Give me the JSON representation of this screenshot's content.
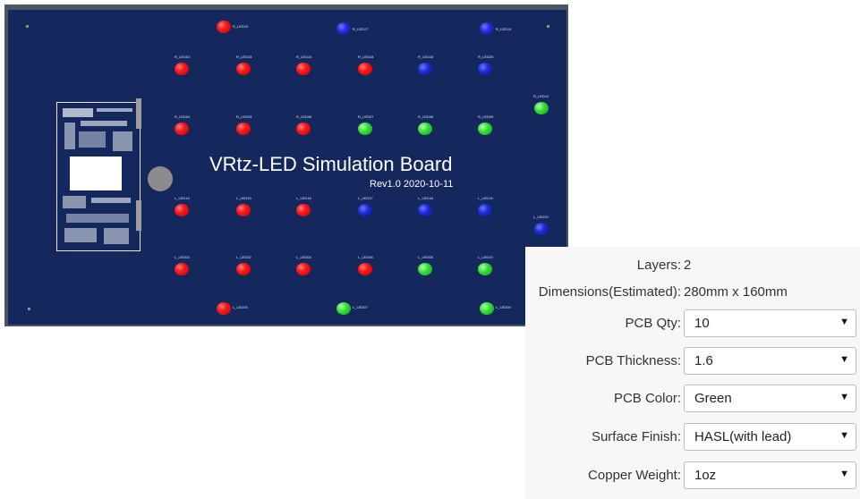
{
  "board": {
    "title": "VRtz-LED Simulation Board",
    "revision": "Rev1.0  2020-10-11",
    "leds": [
      {
        "label": "R_LED13",
        "color": "red"
      },
      {
        "label": "R_LED17",
        "color": "blue"
      },
      {
        "label": "R_LED19",
        "color": "blue"
      },
      {
        "label": "R_LED03",
        "color": "red"
      },
      {
        "label": "R_LED15",
        "color": "red"
      },
      {
        "label": "R_LED14",
        "color": "red"
      },
      {
        "label": "R_LED18",
        "color": "red"
      },
      {
        "label": "R_LED16",
        "color": "blue"
      },
      {
        "label": "R_LED20",
        "color": "blue"
      },
      {
        "label": "R_LED12",
        "color": "green"
      },
      {
        "label": "R_LED04",
        "color": "red"
      },
      {
        "label": "R_LED05",
        "color": "red"
      },
      {
        "label": "R_LED06",
        "color": "red"
      },
      {
        "label": "R_LED07",
        "color": "green"
      },
      {
        "label": "R_LED08",
        "color": "green"
      },
      {
        "label": "R_LED09",
        "color": "green"
      },
      {
        "label": "L_LED14",
        "color": "red"
      },
      {
        "label": "L_LED15",
        "color": "red"
      },
      {
        "label": "L_LED16",
        "color": "red"
      },
      {
        "label": "L_LED17",
        "color": "blue"
      },
      {
        "label": "L_LED18",
        "color": "blue"
      },
      {
        "label": "L_LED19",
        "color": "blue"
      },
      {
        "label": "L_LED20",
        "color": "blue"
      },
      {
        "label": "L_LED03",
        "color": "red"
      },
      {
        "label": "L_LED02",
        "color": "red"
      },
      {
        "label": "L_LED04",
        "color": "red"
      },
      {
        "label": "L_LED06",
        "color": "red"
      },
      {
        "label": "L_LED08",
        "color": "green"
      },
      {
        "label": "L_LED10",
        "color": "green"
      },
      {
        "label": "L_LED05",
        "color": "red"
      },
      {
        "label": "L_LED07",
        "color": "green"
      },
      {
        "label": "L_LED09",
        "color": "green"
      }
    ]
  },
  "specs": {
    "layers_label": "Layers:",
    "layers_value": "2",
    "dimensions_label": "Dimensions(Estimated):",
    "dimensions_value": "280mm x 160mm",
    "fields": [
      {
        "label": "PCB Qty:",
        "value": "10"
      },
      {
        "label": "PCB Thickness:",
        "value": "1.6"
      },
      {
        "label": "PCB Color:",
        "value": "Green"
      },
      {
        "label": "Surface Finish:",
        "value": "HASL(with lead)"
      },
      {
        "label": "Copper Weight:",
        "value": "1oz"
      }
    ],
    "dropdown_arrow": "▼"
  }
}
